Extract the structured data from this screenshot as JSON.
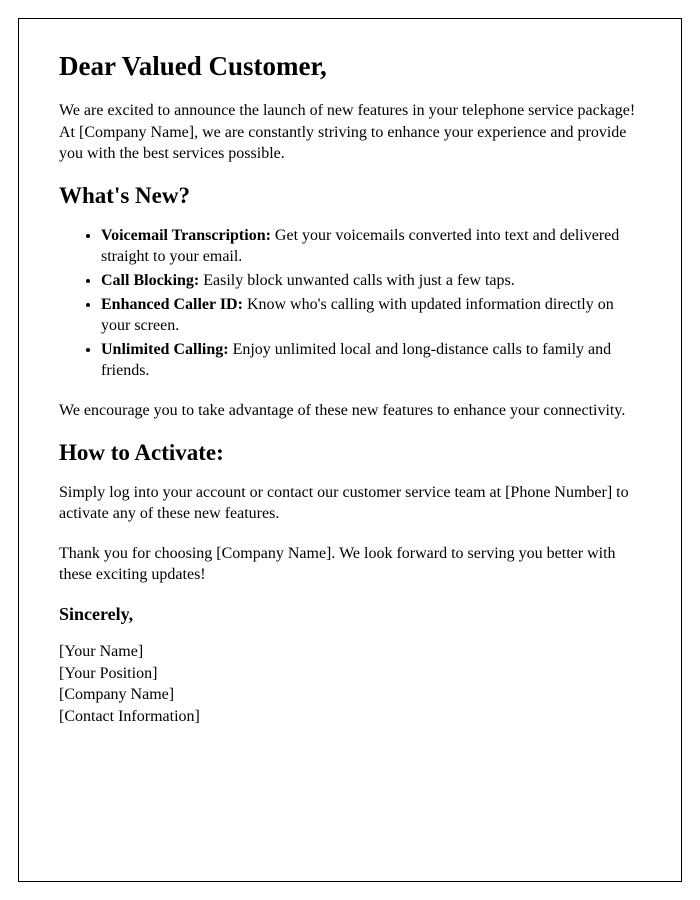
{
  "salutation": "Dear Valued Customer,",
  "intro": "We are excited to announce the launch of new features in your telephone service package! At [Company Name], we are constantly striving to enhance your experience and provide you with the best services possible.",
  "section1_heading": "What's New?",
  "features": [
    {
      "title": "Voicemail Transcription:",
      "desc": " Get your voicemails converted into text and delivered straight to your email."
    },
    {
      "title": "Call Blocking:",
      "desc": " Easily block unwanted calls with just a few taps."
    },
    {
      "title": "Enhanced Caller ID:",
      "desc": " Know who's calling with updated information directly on your screen."
    },
    {
      "title": "Unlimited Calling:",
      "desc": " Enjoy unlimited local and long-distance calls to family and friends."
    }
  ],
  "encourage": "We encourage you to take advantage of these new features to enhance your connectivity.",
  "section2_heading": "How to Activate:",
  "activate": "Simply log into your account or contact our customer service team at [Phone Number] to activate any of these new features.",
  "thanks": "Thank you for choosing [Company Name]. We look forward to serving you better with these exciting updates!",
  "closing": "Sincerely,",
  "signature": {
    "name": "[Your Name]",
    "position": "[Your Position]",
    "company": "[Company Name]",
    "contact": "[Contact Information]"
  }
}
